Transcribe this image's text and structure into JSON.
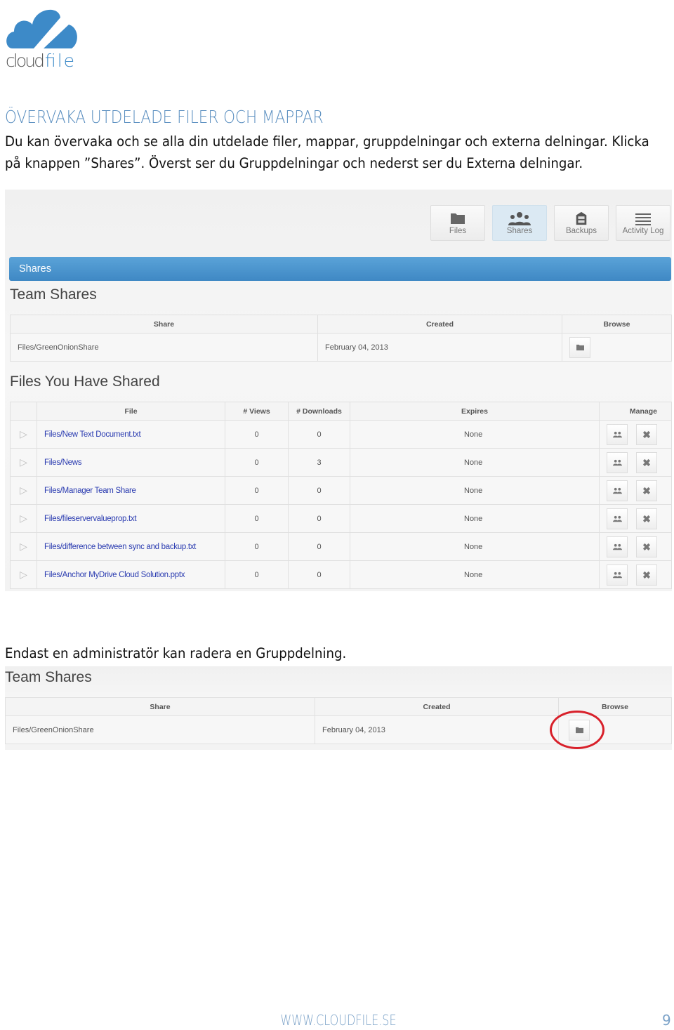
{
  "logo": {
    "text_a": "cloud",
    "text_b": "file",
    "color": "#3d8ac8"
  },
  "heading": "ÖVERVAKA UTDELADE FILER OCH MAPPAR",
  "intro": "Du kan övervaka och se alla din utdelade filer, mappar, gruppdelningar och externa delningar. Klicka på knappen ”Shares”. Överst ser du Gruppdelningar och nederst ser du Externa delningar.",
  "toolbar": [
    {
      "label": "Files",
      "icon": "folder-icon"
    },
    {
      "label": "Shares",
      "icon": "users-icon",
      "active": true
    },
    {
      "label": "Backups",
      "icon": "cabinet-icon"
    },
    {
      "label": "Activity Log",
      "icon": "list-icon"
    }
  ],
  "panel_title": "Shares",
  "team_shares": {
    "title": "Team Shares",
    "headers": [
      "Share",
      "Created",
      "Browse"
    ],
    "rows": [
      {
        "share": "Files/GreenOnionShare",
        "created": "February 04, 2013"
      }
    ]
  },
  "files_shared": {
    "title": "Files You Have Shared",
    "headers": [
      "File",
      "# Views",
      "# Downloads",
      "Expires",
      "Manage"
    ],
    "rows": [
      {
        "file": "Files/New Text Document.txt",
        "views": "0",
        "downloads": "0",
        "expires": "None"
      },
      {
        "file": "Files/News",
        "views": "0",
        "downloads": "3",
        "expires": "None"
      },
      {
        "file": "Files/Manager Team Share",
        "views": "0",
        "downloads": "0",
        "expires": "None"
      },
      {
        "file": "Files/fileservervalueprop.txt",
        "views": "0",
        "downloads": "0",
        "expires": "None"
      },
      {
        "file": "Files/difference between sync and backup.txt",
        "views": "0",
        "downloads": "0",
        "expires": "None"
      },
      {
        "file": "Files/Anchor MyDrive Cloud Solution.pptx",
        "views": "0",
        "downloads": "0",
        "expires": "None"
      }
    ]
  },
  "after_text": "Endast en administratör kan radera en Gruppdelning.",
  "team_shares_2": {
    "title": "Team Shares",
    "headers": [
      "Share",
      "Created",
      "Browse"
    ],
    "rows": [
      {
        "share": "Files/GreenOnionShare",
        "created": "February 04, 2013"
      }
    ]
  },
  "footer": {
    "url": "WWW.CLOUDFILE.SE",
    "page": "9"
  }
}
